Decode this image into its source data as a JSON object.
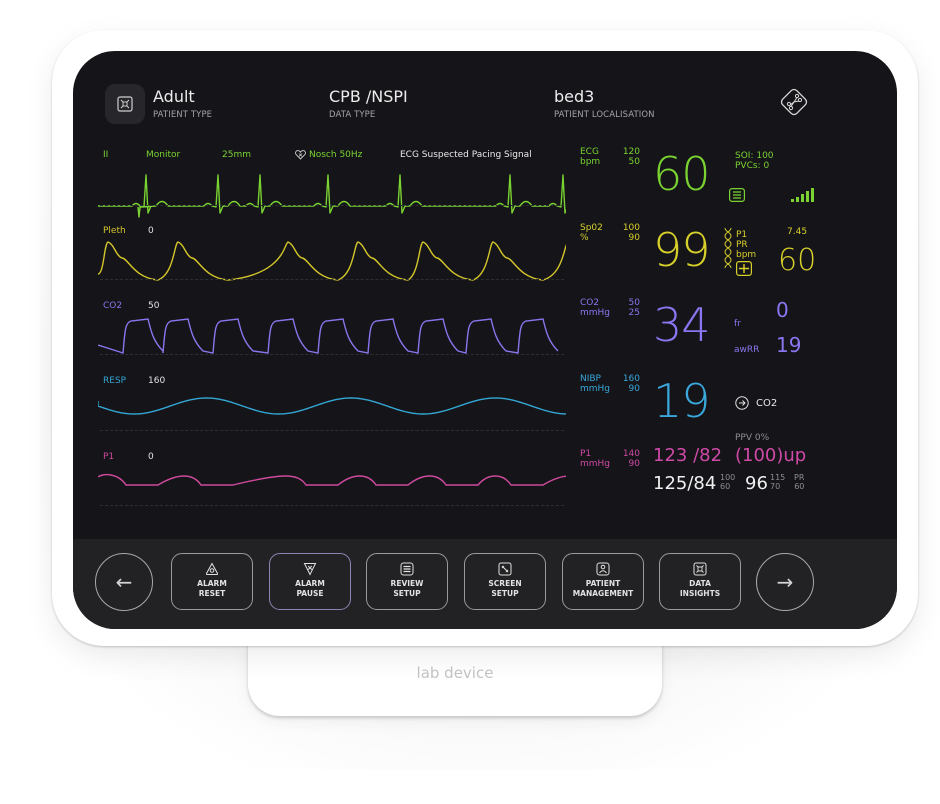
{
  "device": {
    "label": "lab device"
  },
  "header": {
    "patient_type": {
      "value": "Adult",
      "label": "PATIENT TYPE"
    },
    "data_type": {
      "value": "CPB /NSPI",
      "label": "DATA TYPE"
    },
    "localisation": {
      "value": "bed3",
      "label": "PATIENT LOCALISATION"
    }
  },
  "ecg_bar": {
    "lead": "II",
    "mode": "Monitor",
    "speed": "25mm",
    "filter": "Nosch 50Hz",
    "message": "ECG Suspected Pacing Signal"
  },
  "waves": [
    {
      "name": "Pleth",
      "scale": "0",
      "color": "#d4c62a"
    },
    {
      "name": "CO2",
      "scale": "50",
      "color": "#8c74ec"
    },
    {
      "name": "RESP",
      "scale": "160",
      "color": "#34a6d4"
    },
    {
      "name": "P1",
      "scale": "0",
      "color": "#d04a9e"
    }
  ],
  "colors": {
    "ecg": "#7bd332",
    "spo2": "#d8d02a",
    "co2": "#8a76f0",
    "nibp": "#3aa8dc",
    "p1": "#cf4aa7",
    "white": "#f0f0f0",
    "grey": "#8e8e92"
  },
  "vitals": {
    "ecg": {
      "label": "ECG",
      "unit": "bpm",
      "high": "120",
      "low": "50",
      "value": "60",
      "soi": "SOI: 100",
      "pvcs": "PVCs: 0",
      "signal_bars": 5
    },
    "spo2": {
      "label": "Sp02",
      "unit": "%",
      "high": "100",
      "low": "90",
      "value": "99",
      "p1_label": "P1",
      "pr_label": "PR",
      "bpm_label": "bpm",
      "p1_value": "7.45",
      "pr_value": "60"
    },
    "co2": {
      "label": "CO2",
      "unit": "mmHg",
      "high": "50",
      "low": "25",
      "value": "34",
      "fr_label": "fr",
      "fr_value": "0",
      "awrr_label": "awRR",
      "awrr_value": "19"
    },
    "nibp": {
      "label": "NIBP",
      "unit": "mmHg",
      "high": "160",
      "low": "90",
      "value": "19",
      "link_label": "CO2",
      "ppv": "PPV 0%"
    },
    "p1": {
      "label": "P1",
      "unit": "mmHg",
      "high": "140",
      "low": "90",
      "value": "123 /82",
      "mean": "(100)up",
      "bp2": "125/84",
      "bp2_high": "100",
      "bp2_low": "60",
      "pr_value": "96",
      "pr_high": "115",
      "pr_low": "70",
      "pr_label": "PR",
      "pr_extra": "60"
    }
  },
  "footer": {
    "back_label": "←",
    "forward_label": "→",
    "buttons": [
      {
        "label": "ALARM\nRESET",
        "icon": "alarm-reset-icon"
      },
      {
        "label": "ALARM\nPAUSE",
        "icon": "alarm-pause-icon"
      },
      {
        "label": "REVIEW\nSETUP",
        "icon": "review-icon"
      },
      {
        "label": "SCREEN\nSETUP",
        "icon": "screen-icon"
      },
      {
        "label": "PATIENT\nMANAGEMENT",
        "icon": "patient-icon"
      },
      {
        "label": "DATA\nINSIGHTS",
        "icon": "data-icon"
      }
    ]
  }
}
